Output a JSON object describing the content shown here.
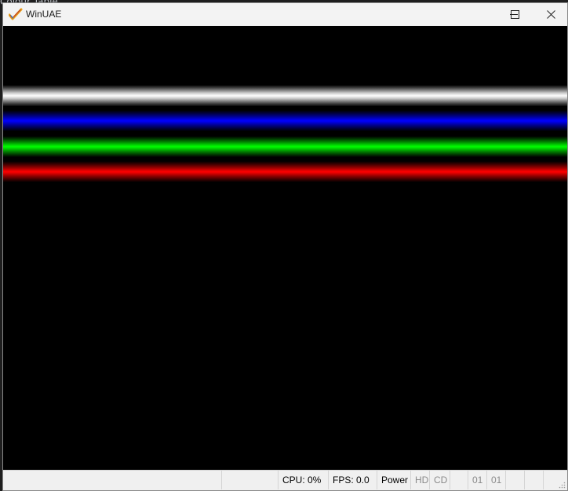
{
  "background": {
    "behind_text": "Colour Table"
  },
  "window": {
    "title": "WinUAE",
    "icons": {
      "app": "winuae-checkmark-icon",
      "minimize": "minimize-icon",
      "maximize": "maximize-icon",
      "close": "close-icon"
    }
  },
  "screen": {
    "bars": [
      {
        "name": "white",
        "color": "#ffffff"
      },
      {
        "name": "blue",
        "color": "#0000ff"
      },
      {
        "name": "green",
        "color": "#00ff00"
      },
      {
        "name": "red",
        "color": "#ff0000"
      }
    ]
  },
  "statusbar": {
    "cpu": "CPU: 0%",
    "fps": "FPS: 0.0",
    "power": "Power",
    "hd": "HD",
    "cd": "CD",
    "drive0": "01",
    "drive1": "01"
  }
}
